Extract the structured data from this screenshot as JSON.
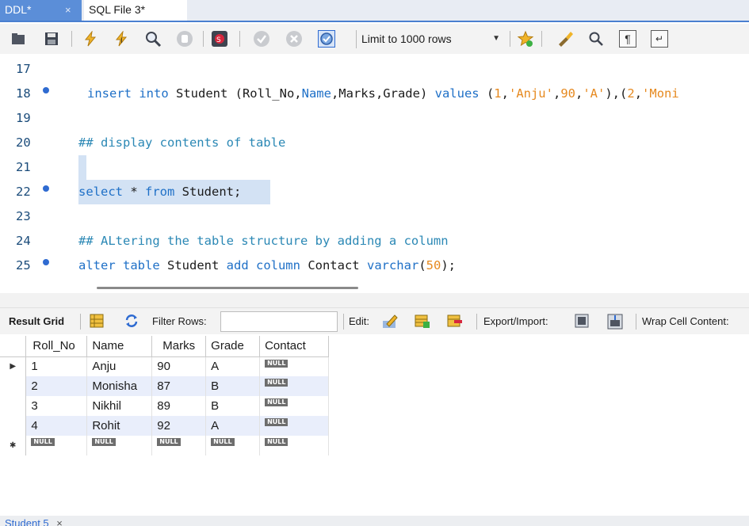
{
  "tabs": [
    {
      "label": "DDL*",
      "close": "×"
    },
    {
      "label": "SQL File 3*"
    }
  ],
  "toolbar": {
    "limit_label": "Limit to 1000 rows",
    "icons": [
      "open-folder-icon",
      "save-icon",
      "execute-icon",
      "execute-current-icon",
      "explain-icon",
      "stop-icon",
      "stop-on-error-icon",
      "commit-icon",
      "rollback-icon",
      "autocommit-icon",
      "snippet-icon",
      "beautify-icon",
      "find-icon",
      "invisible-chars-icon",
      "wrap-icon"
    ]
  },
  "editor": {
    "lines": [
      {
        "num": "17"
      },
      {
        "num": "18"
      },
      {
        "num": "19"
      },
      {
        "num": "20",
        "comment": "## display contents of table"
      },
      {
        "num": "21"
      },
      {
        "num": "22"
      },
      {
        "num": "23"
      },
      {
        "num": "24",
        "comment": "## ALtering the table structure by adding a column"
      },
      {
        "num": "25"
      }
    ],
    "l18": {
      "kw1": "insert into",
      "t1": " Student (Roll_No,",
      "kw2": "Name",
      "t2": ",Marks,Grade) ",
      "kw3": "values",
      "t3": " (",
      "n1": "1",
      "t4": ",",
      "s1": "'Anju'",
      "t5": ",",
      "n2": "90",
      "t6": ",",
      "s2": "'A'",
      "t7": "),(",
      "n3": "2",
      "t8": ",",
      "s3": "'Moni"
    },
    "l22": {
      "kw1": "select",
      "t1": " * ",
      "kw2": "from",
      "t2": " Student;"
    },
    "l25": {
      "kw1": "alter table",
      "t1": " Student ",
      "kw2": "add column",
      "t2": " Contact ",
      "kw3": "varchar",
      "t3": "(",
      "n1": "50",
      "t4": ");"
    }
  },
  "result_toolbar": {
    "result_grid": "Result Grid",
    "filter_rows": "Filter Rows:",
    "filter_value": "",
    "edit": "Edit:",
    "export_import": "Export/Import:",
    "wrap": "Wrap Cell Content:"
  },
  "grid": {
    "columns": [
      "Roll_No",
      "Name",
      "Marks",
      "Grade",
      "Contact"
    ],
    "rows": [
      [
        "1",
        "Anju",
        "90",
        "A",
        "NULL"
      ],
      [
        "2",
        "Monisha",
        "87",
        "B",
        "NULL"
      ],
      [
        "3",
        "Nikhil",
        "89",
        "B",
        "NULL"
      ],
      [
        "4",
        "Rohit",
        "92",
        "A",
        "NULL"
      ]
    ],
    "new_row": [
      "NULL",
      "NULL",
      "NULL",
      "NULL",
      "NULL"
    ],
    "current_row_marker": "▶",
    "new_row_marker": "✱"
  },
  "bottom_tab": {
    "label": "Student 5",
    "close": "×"
  },
  "colors": {
    "accent": "#4a7fd0",
    "keyword": "#1f70c7",
    "comment": "#2b88b5",
    "string": "#e6891f",
    "selection": "#d3e2f4"
  }
}
